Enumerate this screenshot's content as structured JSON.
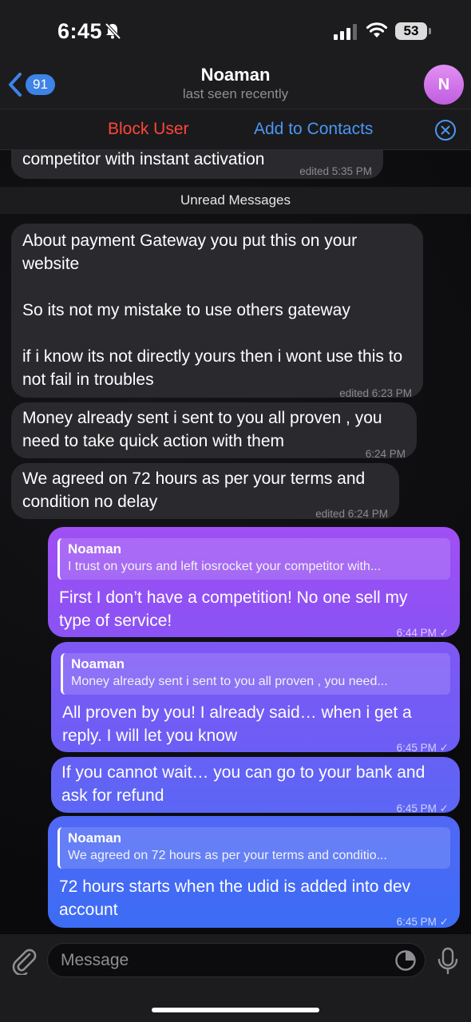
{
  "status_bar": {
    "time": "6:45",
    "battery": "53"
  },
  "header": {
    "back_count": "91",
    "title": "Noaman",
    "subtitle": "last seen recently",
    "avatar_letter": "N"
  },
  "actions": {
    "block": "Block User",
    "add": "Add to Contacts"
  },
  "unread_label": "Unread Messages",
  "incoming": [
    {
      "text": "competitor with instant activation",
      "meta": "edited 5:35 PM"
    },
    {
      "text": "About payment Gateway you put this on your website\n\nSo its not my mistake to use others gateway\n\nif i know its not directly yours then i wont use this to not fail in troubles",
      "meta": "edited 6:23 PM"
    },
    {
      "text": "Money already sent i sent to you all proven , you need to take quick action with them",
      "meta": "6:24 PM"
    },
    {
      "text": "We agreed on 72 hours as per your terms and condition no delay",
      "meta": "edited 6:24 PM"
    }
  ],
  "outgoing": [
    {
      "quote_name": "Noaman",
      "quote_text": "I trust on yours and left iosrocket your competitor with...",
      "text": "First I don’t have a competition! No one sell my type of service!",
      "meta": "6:44 PM ✓"
    },
    {
      "quote_name": "Noaman",
      "quote_text": "Money already sent i sent to you all proven , you need...",
      "text": "All proven by you! I already said… when i get a reply. I will let you know",
      "meta": "6:45 PM ✓"
    },
    {
      "text": "If you cannot wait… you can go to your bank and ask for refund",
      "meta": "6:45 PM ✓"
    },
    {
      "quote_name": "Noaman",
      "quote_text": "We agreed on 72 hours as per your terms and conditio...",
      "text": "72 hours starts when the udid is added into dev account",
      "meta": "6:45 PM ✓"
    }
  ],
  "input": {
    "placeholder": "Message"
  },
  "colors": {
    "accent": "#3e83e6",
    "danger": "#ff453a",
    "outgoing_top": "#9d4ff4",
    "outgoing_bottom": "#3d6cf5"
  }
}
